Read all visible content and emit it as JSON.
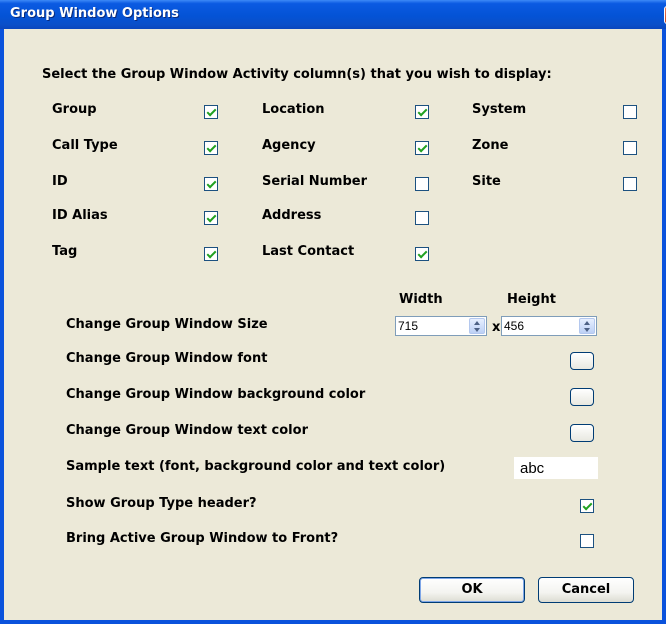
{
  "window": {
    "title": "Group Window Options",
    "close_glyph": "×"
  },
  "instructions": "Select the Group Window Activity column(s) that you wish to display:",
  "columns": [
    [
      {
        "label": "Group",
        "checked": true
      },
      {
        "label": "Call Type",
        "checked": true
      },
      {
        "label": "ID",
        "checked": true
      },
      {
        "label": "ID Alias",
        "checked": true
      },
      {
        "label": "Tag",
        "checked": true
      }
    ],
    [
      {
        "label": "Location",
        "checked": true
      },
      {
        "label": "Agency",
        "checked": true
      },
      {
        "label": "Serial Number",
        "checked": false
      },
      {
        "label": "Address",
        "checked": false
      },
      {
        "label": "Last Contact",
        "checked": true
      }
    ],
    [
      {
        "label": "System",
        "checked": false
      },
      {
        "label": "Zone",
        "checked": false
      },
      {
        "label": "Site",
        "checked": false
      }
    ]
  ],
  "size": {
    "width_header": "Width",
    "height_header": "Height",
    "width_value": "715",
    "height_value": "456",
    "separator": "x"
  },
  "options": {
    "change_size_label": "Change Group Window Size",
    "change_font_label": "Change Group Window font",
    "change_bg_label": "Change Group Window background color",
    "change_text_color_label": "Change Group Window text color",
    "sample_label": "Sample text (font, background color and text color)",
    "sample_text": "abc",
    "show_header_label": "Show Group Type header?",
    "show_header_checked": true,
    "bring_front_label": "Bring Active Group Window to Front?",
    "bring_front_checked": false
  },
  "buttons": {
    "ok": "OK",
    "cancel": "Cancel"
  },
  "colors": {
    "title_bar": "#0453d6",
    "dialog_bg": "#ece9d8",
    "check_mark": "#21a121"
  }
}
